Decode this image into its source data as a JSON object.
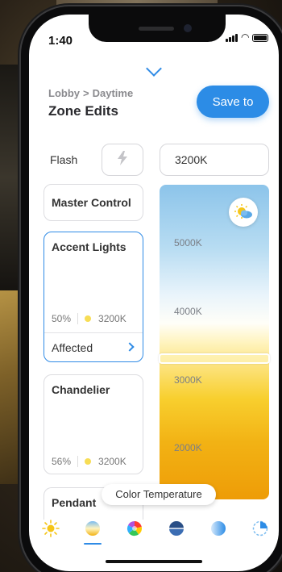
{
  "status": {
    "time": "1:40"
  },
  "header": {
    "breadcrumb": [
      "Lobby",
      "Daytime"
    ],
    "breadcrumb_sep": ">",
    "title": "Zone Edits",
    "save_label": "Save to"
  },
  "controls": {
    "flash_label": "Flash",
    "temperature_value": "3200K"
  },
  "zones": [
    {
      "name": "Master Control"
    },
    {
      "name": "Accent Lights",
      "brightness": "50%",
      "temp": "3200K",
      "affected_label": "Affected",
      "selected": true
    },
    {
      "name": "Chandelier",
      "brightness": "56%",
      "temp": "3200K"
    },
    {
      "name": "Pendant"
    }
  ],
  "slider": {
    "ticks": [
      "5000K",
      "4000K",
      "3000K",
      "2000K"
    ],
    "value": "3200K"
  },
  "tooltip": "Color Temperature",
  "toolbar": {
    "items": [
      "brightness-icon",
      "color-temperature-icon",
      "color-wheel-icon",
      "scene-icon",
      "saturation-icon",
      "timer-icon"
    ],
    "selected": "color-temperature-icon"
  },
  "colors": {
    "accent": "#2f8be6",
    "warm": "#f2b214"
  }
}
